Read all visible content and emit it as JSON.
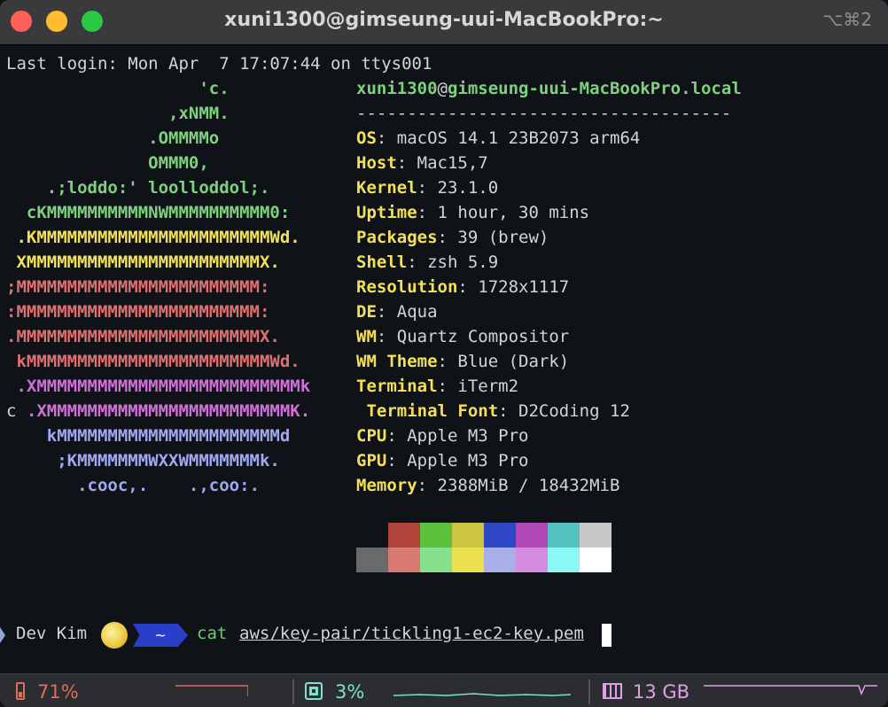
{
  "window": {
    "title": "xuni1300@gimseung-uui-MacBookPro:~",
    "shortcut": "⌥⌘2"
  },
  "terminal": {
    "last_login": "Last login: Mon Apr  7 17:07:44 on ttys001",
    "ascii_logo": [
      {
        "text": "                   'c.",
        "color": "#7fd07f"
      },
      {
        "text": "                ,xNMM.",
        "color": "#7fd07f"
      },
      {
        "text": "              .OMMMMo",
        "color": "#7fd07f"
      },
      {
        "text": "              OMMM0,",
        "color": "#7fd07f"
      },
      {
        "text": "    .;loddo:' loolloddol;.",
        "color": "#7fd07f"
      },
      {
        "text": "  cKMMMMMMMMMMNWMMMMMMMMMM0:",
        "color": "#7fd07f"
      },
      {
        "text": " .KMMMMMMMMMMMMMMMMMMMMMMMWd.",
        "color": "#f2e05a"
      },
      {
        "text": " XMMMMMMMMMMMMMMMMMMMMMMMX.",
        "color": "#f2e05a"
      },
      {
        "text": ";MMMMMMMMMMMMMMMMMMMMMMMM:",
        "color": "#e07070"
      },
      {
        "text": ":MMMMMMMMMMMMMMMMMMMMMMMM:",
        "color": "#e07070"
      },
      {
        "text": ".MMMMMMMMMMMMMMMMMMMMMMMMX.",
        "color": "#e07070"
      },
      {
        "text": " kMMMMMMMMMMMMMMMMMMMMMMMMWd.",
        "color": "#e07070"
      },
      {
        "text": " .XMMMMMMMMMMMMMMMMMMMMMMMMMMk",
        "color": "#d070d8"
      },
      {
        "text": "  .XMMMMMMMMMMMMMMMMMMMMMMMMK.",
        "color": "#d070d8"
      },
      {
        "text": "    kMMMMMMMMMMMMMMMMMMMMMMd",
        "color": "#9fa8f0"
      },
      {
        "text": "     ;KMMMMMMMWXXWMMMMMMMk.",
        "color": "#9fa8f0"
      },
      {
        "text": "       .cooc,.    .,coo:.",
        "color": "#9fa8f0"
      }
    ],
    "stray_c": "c",
    "user_host": {
      "user": "xuni1300",
      "at": "@",
      "host": "gimseung-uui-MacBookPro.local"
    },
    "separator": "-------------------------------------",
    "info": [
      {
        "label": "OS",
        "value": " macOS 14.1 23B2073 arm64"
      },
      {
        "label": "Host",
        "value": " Mac15,7"
      },
      {
        "label": "Kernel",
        "value": " 23.1.0"
      },
      {
        "label": "Uptime",
        "value": " 1 hour, 30 mins"
      },
      {
        "label": "Packages",
        "value": " 39 (brew)"
      },
      {
        "label": "Shell",
        "value": " zsh 5.9"
      },
      {
        "label": "Resolution",
        "value": " 1728x1117"
      },
      {
        "label": "DE",
        "value": " Aqua"
      },
      {
        "label": "WM",
        "value": " Quartz Compositor"
      },
      {
        "label": "WM Theme",
        "value": " Blue (Dark)"
      },
      {
        "label": "Terminal",
        "value": " iTerm2"
      },
      {
        "label": " Terminal Font",
        "value": " D2Coding 12"
      },
      {
        "label": "CPU",
        "value": " Apple M3 Pro"
      },
      {
        "label": "GPU",
        "value": " Apple M3 Pro"
      },
      {
        "label": "Memory",
        "value": " 2388MiB / 18432MiB"
      }
    ],
    "palette_top": [
      "#0f1217",
      "#b0443a",
      "#5cc13c",
      "#cdc43f",
      "#2f48c8",
      "#b148b8",
      "#55c2c2",
      "#c8c8c8"
    ],
    "palette_bottom": [
      "#6a6a6a",
      "#d67a72",
      "#86e08c",
      "#ebe04e",
      "#a7aeea",
      "#d58be0",
      "#8cf8f8",
      "#ffffff"
    ]
  },
  "prompt": {
    "name": "Dev Kim",
    "dir": "~",
    "command": "cat",
    "argument": "aws/key-pair/tickling1-ec2-key.pem"
  },
  "statusbar": {
    "battery": "71%",
    "cpu": "3%",
    "memory": "13 GB"
  }
}
